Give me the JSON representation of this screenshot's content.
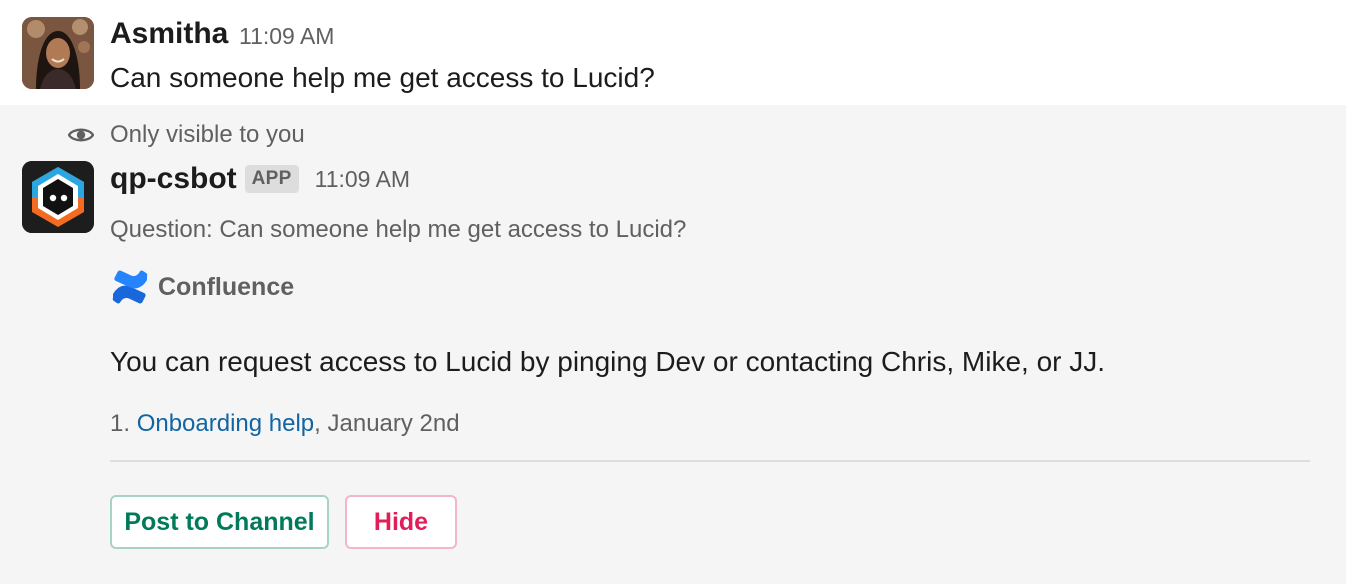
{
  "messages": {
    "user": {
      "name": "Asmitha",
      "time": "11:09 AM",
      "text": "Can someone help me get access to Lucid?"
    },
    "bot": {
      "visibility": "Only visible to you",
      "name": "qp-csbot",
      "badge": "APP",
      "time": "11:09 AM",
      "question": "Question: Can someone help me get access to Lucid?",
      "source": "Confluence",
      "answer": "You can request access to Lucid by pinging Dev or contacting Chris, Mike, or JJ.",
      "citation": {
        "number": "1.",
        "link_text": "Onboarding help",
        "date": ", January 2nd"
      },
      "buttons": {
        "post": "Post to Channel",
        "hide": "Hide"
      }
    }
  },
  "colors": {
    "link": "#1264a3",
    "post_button": "#007a5a",
    "hide_button": "#e01e5a",
    "ephemeral_bg": "#f4f5f4"
  },
  "icons": {
    "visibility": "eye-icon",
    "source": "confluence-icon"
  }
}
